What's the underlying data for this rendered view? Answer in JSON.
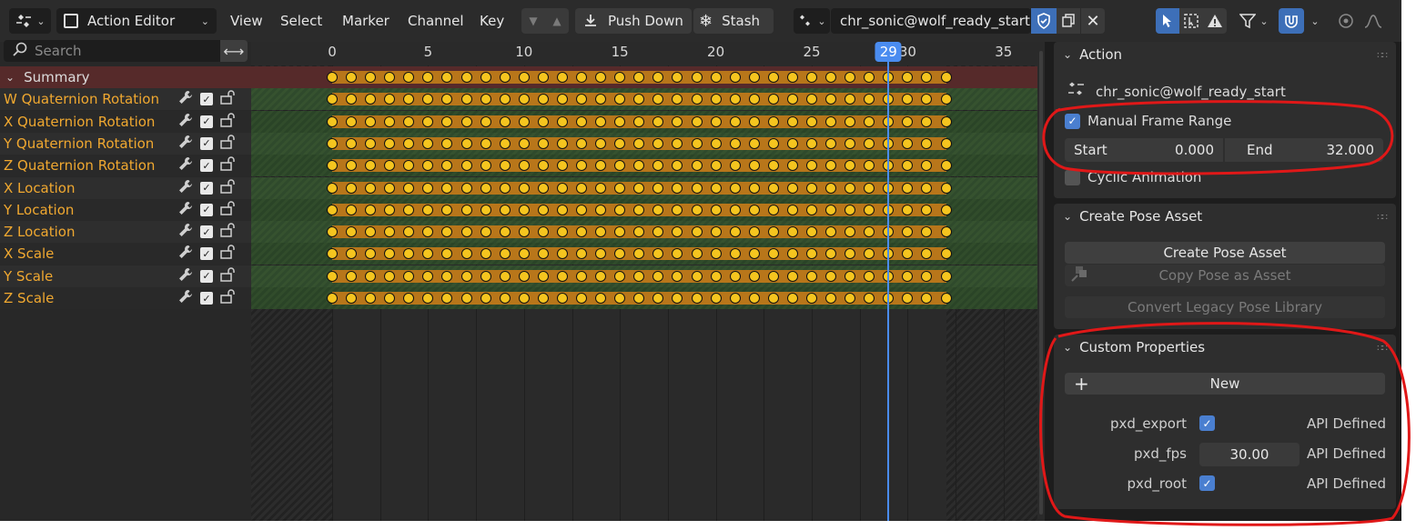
{
  "header": {
    "editor_type": "Action Editor",
    "menus": [
      "View",
      "Select",
      "Marker",
      "Channel",
      "Key"
    ],
    "push_down": "Push Down",
    "stash": "Stash",
    "action_name": "chr_sonic@wolf_ready_start"
  },
  "channels": {
    "search_placeholder": "Search",
    "summary": "Summary",
    "items": [
      "W Quaternion Rotation",
      "X Quaternion Rotation",
      "Y Quaternion Rotation",
      "Z Quaternion Rotation",
      "X Location",
      "Y Location",
      "Z Location",
      "X Scale",
      "Y Scale",
      "Z Scale"
    ]
  },
  "timeline": {
    "ticks": [
      "0",
      "5",
      "10",
      "15",
      "20",
      "25",
      "30",
      "35"
    ],
    "current_frame": "29",
    "keyframe_start": 0,
    "keyframe_end": 32,
    "keyframe_step": 1
  },
  "sidebar": {
    "action_panel": {
      "title": "Action",
      "action_name": "chr_sonic@wolf_ready_start",
      "manual_frame_range_label": "Manual Frame Range",
      "manual_frame_range_checked": true,
      "start_label": "Start",
      "start_value": "0.000",
      "end_label": "End",
      "end_value": "32.000",
      "cyclic_label": "Cyclic Animation",
      "cyclic_checked": false
    },
    "pose_panel": {
      "title": "Create Pose Asset",
      "create_btn": "Create Pose Asset",
      "copy_btn": "Copy Pose as Asset",
      "convert_btn": "Convert Legacy Pose Library"
    },
    "custom_panel": {
      "title": "Custom Properties",
      "new_btn": "New",
      "props": [
        {
          "name": "pxd_export",
          "kind": "checkbox",
          "value": "",
          "api": "API Defined"
        },
        {
          "name": "pxd_fps",
          "kind": "number",
          "value": "30.00",
          "api": "API Defined"
        },
        {
          "name": "pxd_root",
          "kind": "checkbox",
          "value": "",
          "api": "API Defined"
        }
      ]
    }
  },
  "colors": {
    "accent": "#4a8cf0",
    "channel_text": "#f0a830",
    "keyframe": "#f5c51f",
    "annotation": "#e01818"
  }
}
